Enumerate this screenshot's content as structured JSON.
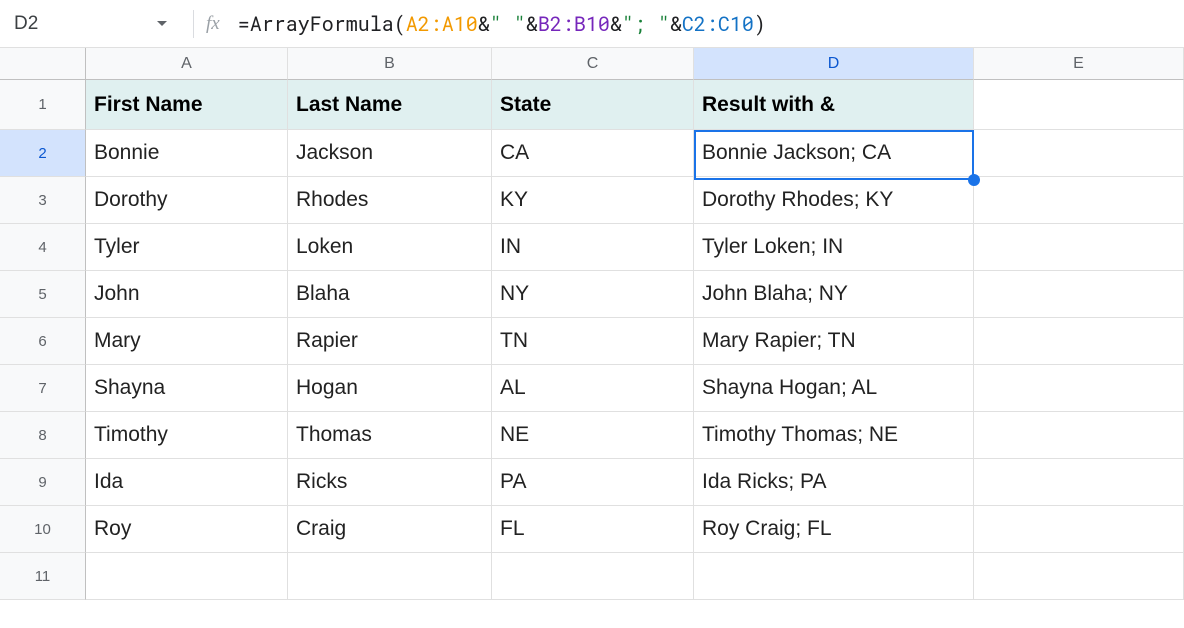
{
  "nameBox": "D2",
  "formula": {
    "prefix": "=ArrayFormula(",
    "refA": "A2:A10",
    "amp1": "&",
    "str1": "\" \"",
    "amp2": "&",
    "refB": "B2:B10",
    "amp3": "&",
    "str2": "\"; \"",
    "amp4": "&",
    "refC": "C2:C10",
    "suffix": ")"
  },
  "columns": [
    "A",
    "B",
    "C",
    "D",
    "E"
  ],
  "selectedColumn": "D",
  "selectedRow": "2",
  "headers": {
    "A": "First Name",
    "B": "Last Name",
    "C": "State",
    "D": "Result with &"
  },
  "rows": [
    {
      "n": "1",
      "isHeader": true,
      "A": "First Name",
      "B": "Last Name",
      "C": "State",
      "D": "Result with &",
      "E": ""
    },
    {
      "n": "2",
      "A": "Bonnie",
      "B": "Jackson",
      "C": "CA",
      "D": "Bonnie Jackson; CA",
      "E": ""
    },
    {
      "n": "3",
      "A": "Dorothy",
      "B": "Rhodes",
      "C": "KY",
      "D": "Dorothy Rhodes; KY",
      "E": ""
    },
    {
      "n": "4",
      "A": "Tyler",
      "B": "Loken",
      "C": "IN",
      "D": "Tyler Loken; IN",
      "E": ""
    },
    {
      "n": "5",
      "A": "John",
      "B": "Blaha",
      "C": "NY",
      "D": "John Blaha; NY",
      "E": ""
    },
    {
      "n": "6",
      "A": "Mary",
      "B": "Rapier",
      "C": "TN",
      "D": "Mary Rapier; TN",
      "E": ""
    },
    {
      "n": "7",
      "A": "Shayna",
      "B": "Hogan",
      "C": "AL",
      "D": "Shayna Hogan; AL",
      "E": ""
    },
    {
      "n": "8",
      "A": "Timothy",
      "B": "Thomas",
      "C": "NE",
      "D": "Timothy Thomas; NE",
      "E": ""
    },
    {
      "n": "9",
      "A": "Ida",
      "B": "Ricks",
      "C": "PA",
      "D": "Ida Ricks; PA",
      "E": ""
    },
    {
      "n": "10",
      "A": "Roy",
      "B": "Craig",
      "C": "FL",
      "D": "Roy Craig; FL",
      "E": ""
    },
    {
      "n": "11",
      "A": "",
      "B": "",
      "C": "",
      "D": "",
      "E": ""
    }
  ],
  "chart_data": {
    "type": "table",
    "title": "",
    "columns": [
      "First Name",
      "Last Name",
      "State",
      "Result with &"
    ],
    "rows": [
      [
        "Bonnie",
        "Jackson",
        "CA",
        "Bonnie Jackson; CA"
      ],
      [
        "Dorothy",
        "Rhodes",
        "KY",
        "Dorothy Rhodes; KY"
      ],
      [
        "Tyler",
        "Loken",
        "IN",
        "Tyler Loken; IN"
      ],
      [
        "John",
        "Blaha",
        "NY",
        "John Blaha; NY"
      ],
      [
        "Mary",
        "Rapier",
        "TN",
        "Mary Rapier; TN"
      ],
      [
        "Shayna",
        "Hogan",
        "AL",
        "Shayna Hogan; AL"
      ],
      [
        "Timothy",
        "Thomas",
        "NE",
        "Timothy Thomas; NE"
      ],
      [
        "Ida",
        "Ricks",
        "PA",
        "Ida Ricks; PA"
      ],
      [
        "Roy",
        "Craig",
        "FL",
        "Roy Craig; FL"
      ]
    ]
  }
}
